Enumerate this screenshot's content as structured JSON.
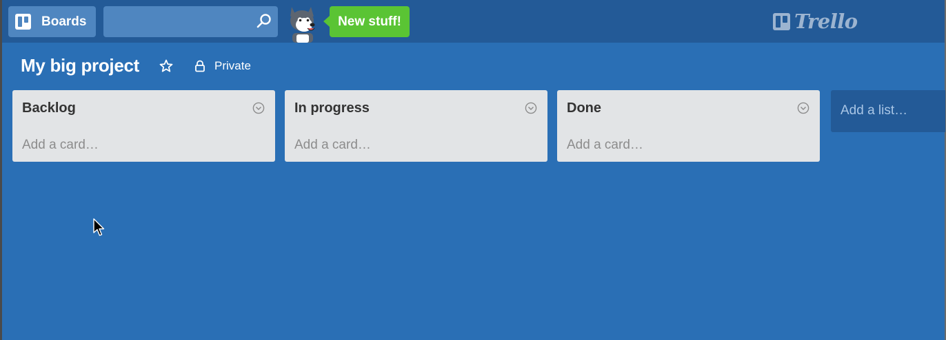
{
  "header": {
    "boards_label": "Boards",
    "search": {
      "value": "",
      "placeholder": ""
    },
    "new_stuff_label": "New stuff!",
    "logo_text": "Trello"
  },
  "board": {
    "title": "My big project",
    "visibility": "Private"
  },
  "lists": [
    {
      "title": "Backlog",
      "add_card": "Add a card…"
    },
    {
      "title": "In progress",
      "add_card": "Add a card…"
    },
    {
      "title": "Done",
      "add_card": "Add a card…"
    }
  ],
  "add_list_label": "Add a list…",
  "colors": {
    "board_bg": "#2a6fb5",
    "header_bg": "#235a97",
    "header_button": "#4f86c0",
    "new_stuff_green": "#5ac434",
    "list_bg": "#e2e4e6"
  },
  "icons": [
    "boards-icon",
    "search-icon",
    "husky-mascot-icon",
    "trello-logo-icon",
    "star-icon",
    "lock-icon",
    "chevron-down-circle-icon",
    "mouse-cursor-icon"
  ]
}
